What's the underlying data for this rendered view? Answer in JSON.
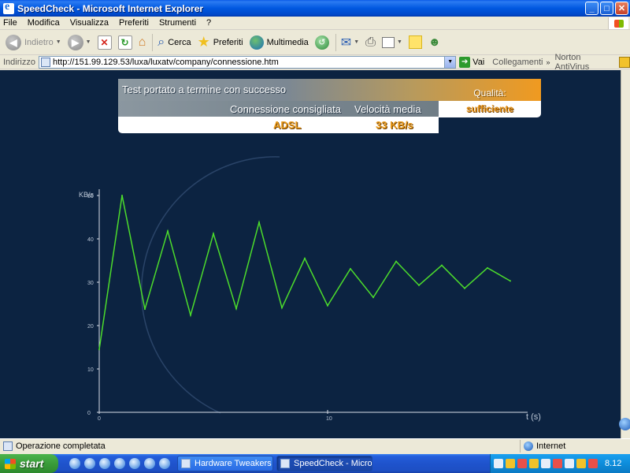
{
  "window": {
    "title": "SpeedCheck - Microsoft Internet Explorer",
    "controls": [
      "_",
      "□",
      "✕"
    ]
  },
  "menu": [
    "File",
    "Modifica",
    "Visualizza",
    "Preferiti",
    "Strumenti",
    "?"
  ],
  "toolbar": {
    "back_label": "Indietro",
    "search_label": "Cerca",
    "favorites_label": "Preferiti",
    "media_label": "Multimedia"
  },
  "address": {
    "label": "Indirizzo",
    "url": "http://151.99.129.53/luxa/luxatv/company/connessione.htm",
    "go_label": "Vai",
    "links_label": "Collegamenti",
    "norton_label": "Norton AntiVirus"
  },
  "result": {
    "status": "Test portato a termine con successo",
    "connection_header": "Connessione consigliata",
    "speed_header": "Velocità media",
    "connection_value": "ADSL",
    "speed_value": "33 KB/s",
    "quality_header": "Qualità:",
    "quality_value": "sufficiente"
  },
  "chart_data": {
    "type": "line",
    "ylabel": "KB/s",
    "xlabel": "t (s)",
    "ylim": [
      0,
      50
    ],
    "xlim": [
      0,
      19
    ],
    "y_ticks": [
      "0",
      "10",
      "20",
      "30",
      "40",
      "50"
    ],
    "x_ticks": [
      {
        "v": 0,
        "label": "0"
      },
      {
        "v": 10,
        "label": "10"
      }
    ],
    "line_color": "#4cdc2c",
    "series": [
      {
        "x": [
          0,
          1,
          2,
          3,
          4,
          5,
          6,
          7,
          8,
          9,
          10,
          11,
          12,
          13,
          14,
          15,
          16,
          17,
          18
        ],
        "values": [
          14.5,
          50,
          23.8,
          41.8,
          22.4,
          41.2,
          23.9,
          43.8,
          24.1,
          35.5,
          24.6,
          33.1,
          26.5,
          34.8,
          29.3,
          33.9,
          28.6,
          33.3,
          30.3
        ]
      }
    ]
  },
  "status_bar": {
    "text": "Operazione completata",
    "zone": "Internet"
  },
  "taskbar": {
    "start_label": "start",
    "tasks": [
      "Hardware Tweakers -...",
      "SpeedCheck - Micros..."
    ],
    "clock": "8.12"
  }
}
